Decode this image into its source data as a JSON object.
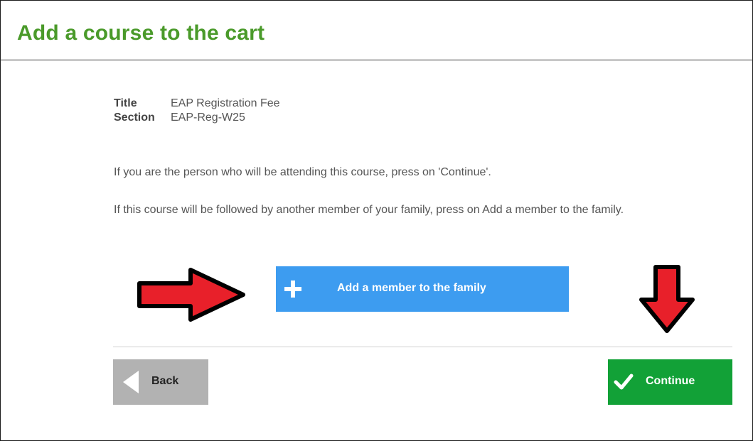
{
  "page": {
    "title": "Add a course to the cart"
  },
  "course": {
    "title_label": "Title",
    "title_value": "EAP Registration Fee",
    "section_label": "Section",
    "section_value": "EAP-Reg-W25"
  },
  "messages": {
    "self": "If you are the person who will be attending this course, press on 'Continue'.",
    "family": "If this course will be followed by another member of your family, press on Add a member to the family."
  },
  "actions": {
    "add_member_label": "Add a member to the family",
    "back_label": "Back",
    "continue_label": "Continue"
  },
  "icons": {
    "add_member": "plus-icon",
    "back": "triangle-left-icon",
    "continue": "checkmark-icon",
    "annotation_right": "red-arrow-right-icon",
    "annotation_down": "red-arrow-down-icon"
  },
  "colors": {
    "title_green": "#4a9a2a",
    "add_member_blue": "#3d9cf0",
    "continue_green": "#12a137",
    "back_gray": "#b2b2b2",
    "annotation_red": "#e8202a"
  }
}
